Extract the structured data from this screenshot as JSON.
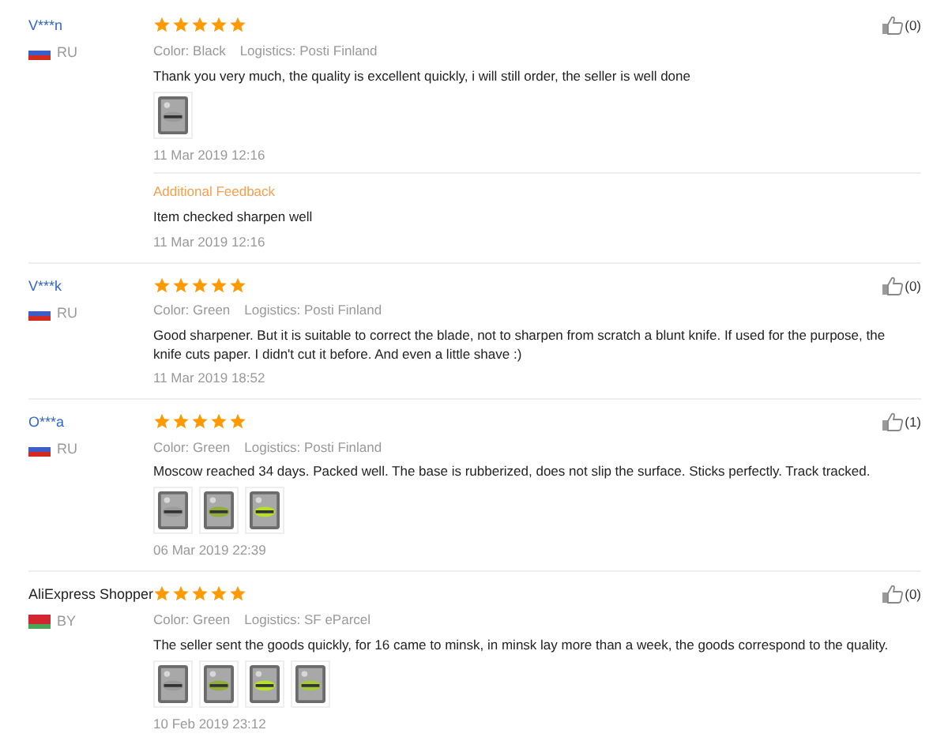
{
  "reviews": [
    {
      "name": "V***n",
      "kind": "masked",
      "flag": {
        "kind": "ru"
      },
      "country": "RU",
      "stars": 5,
      "variant": "Color: Black",
      "logistics": "Logistics: Posti Finland",
      "text": "Thank you very much, the quality is excellent quickly, i will still order, the seller is well done",
      "photos": [
        {
          "kind": "picture"
        }
      ],
      "date": "11 Mar 2019 12:16",
      "helpful": "(0)",
      "additional_feedback": {
        "title": "Additional Feedback",
        "text": "Item checked sharpen well",
        "date": "11 Mar 2019 12:16"
      }
    },
    {
      "name": "V***k",
      "kind": "masked",
      "flag": {
        "kind": "ru"
      },
      "country": "RU",
      "stars": 5,
      "variant": "Color: Green",
      "logistics": "Logistics: Posti Finland",
      "text": "Good sharpener. But it is suitable to correct the blade, not to sharpen from scratch a blunt knife. If used for the purpose, the knife cuts paper. I didn't cut it before. And even a little shave :)",
      "date": "11 Mar 2019 18:52",
      "helpful": "(0)"
    },
    {
      "name": "O***a",
      "kind": "masked",
      "flag": {
        "kind": "ru"
      },
      "country": "RU",
      "stars": 5,
      "variant": "Color: Green",
      "logistics": "Logistics: Posti Finland",
      "text": "Moscow reached 34 days. Packed well. The base is rubberized, does not slip the surface. Sticks perfectly. Track tracked.",
      "photos": [
        {
          "kind": "picture"
        },
        {
          "kind": "picture"
        },
        {
          "kind": "picture"
        }
      ],
      "date": "06 Mar 2019 22:39",
      "helpful": "(1)"
    },
    {
      "name": "AliExpress Shopper",
      "kind": "shopper",
      "flag": {
        "kind": "by"
      },
      "country": "BY",
      "stars": 5,
      "variant": "Color: Green",
      "logistics": "Logistics: SF eParcel",
      "text": "The seller sent the goods quickly, for 16 came to minsk, in minsk lay more than a week, the goods correspond to the quality.",
      "photos": [
        {
          "kind": "picture"
        },
        {
          "kind": "picture"
        },
        {
          "kind": "picture"
        },
        {
          "kind": "picture"
        }
      ],
      "date": "10 Feb 2019 23:12",
      "helpful": "(0)"
    }
  ]
}
